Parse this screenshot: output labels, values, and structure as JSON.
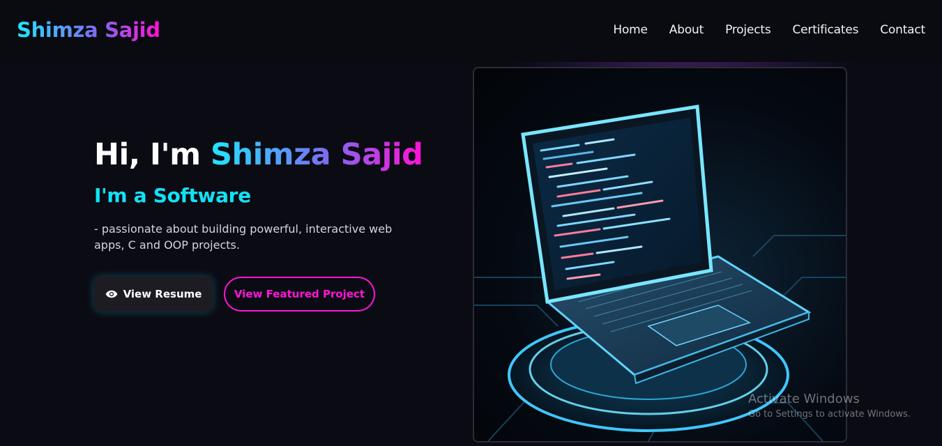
{
  "brand": {
    "name": "Shimza Sajid"
  },
  "nav": {
    "items": [
      "Home",
      "About",
      "Projects",
      "Certificates",
      "Contact"
    ]
  },
  "hero": {
    "greeting": "Hi, I'm ",
    "name": "Shimza Sajid",
    "subtitle": "I'm a Software",
    "description": "- passionate about building powerful, interactive web apps, C and OOP projects.",
    "resume_button": "View Resume",
    "project_button": "View Featured Project",
    "resume_icon": "eye-icon",
    "image_subject": "laptop-illustration"
  },
  "watermark": {
    "title": "Activate Windows",
    "subtitle": "Go to Settings to activate Windows."
  },
  "colors": {
    "background": "#0b0b14",
    "navbar": "#0a0a11",
    "cyan": "#1fe7ff",
    "magenta": "#ff12d3",
    "subtitle": "#12e2f5"
  }
}
